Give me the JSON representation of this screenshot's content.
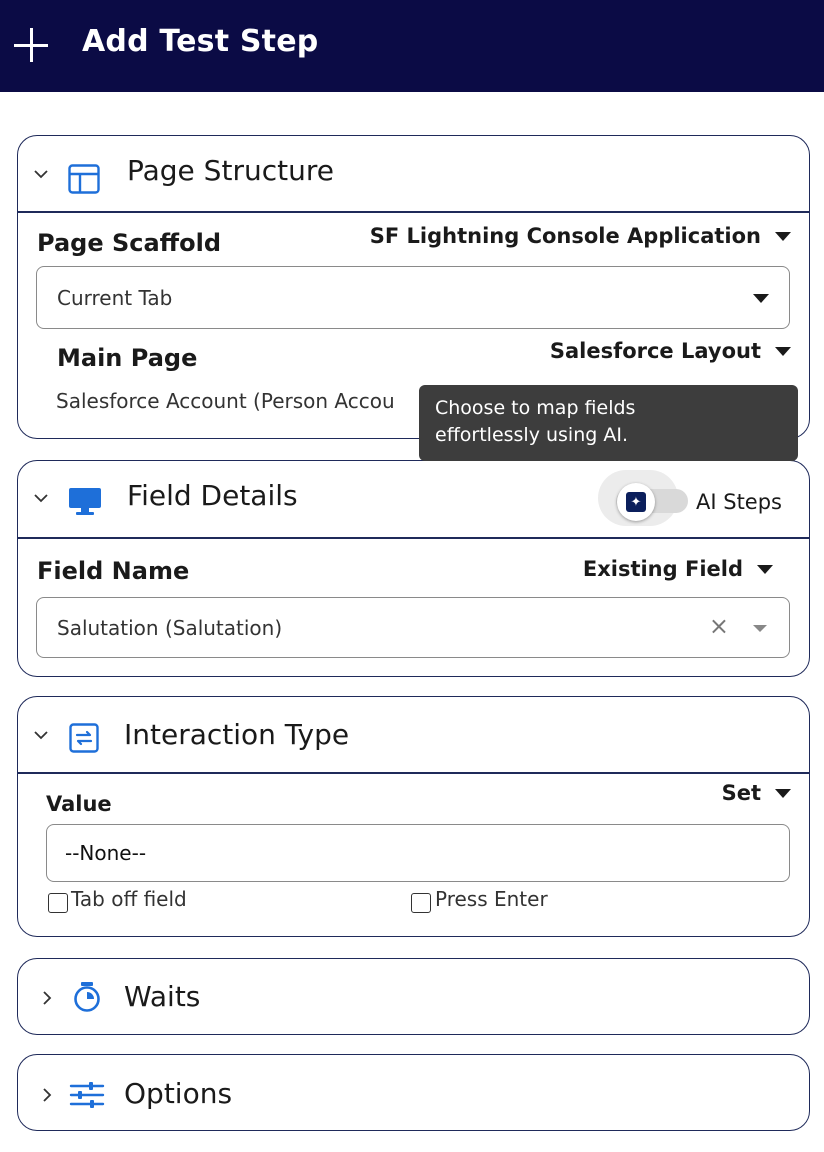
{
  "header": {
    "title": "Add Test Step",
    "icon": "plus-icon"
  },
  "page_structure": {
    "title": "Page Structure",
    "icon": "layout-icon",
    "scaffold_label": "Page Scaffold",
    "scaffold_mode": "SF Lightning Console Application",
    "scaffold_value": "Current Tab",
    "main_page_label": "Main Page",
    "main_page_mode": "Salesforce Layout",
    "main_page_value": "Salesforce Account (Person Accou"
  },
  "tooltip": {
    "line1": "Choose to map fields",
    "line2": "effortlessly using AI."
  },
  "field_details": {
    "title": "Field Details",
    "icon": "monitor-icon",
    "ai_toggle_label": "AI Steps",
    "ai_toggle_on": false,
    "field_name_label": "Field Name",
    "field_mode": "Existing Field",
    "field_value": "Salutation (Salutation)",
    "clear_glyph": "×"
  },
  "interaction_type": {
    "title": "Interaction Type",
    "icon": "interaction-icon",
    "value_label": "Value",
    "action": "Set",
    "value": "--None--",
    "tab_off_label": "Tab off field",
    "tab_off_checked": false,
    "press_enter_label": "Press Enter",
    "press_enter_checked": false
  },
  "waits": {
    "title": "Waits",
    "icon": "stopwatch-icon",
    "expanded": false
  },
  "options": {
    "title": "Options",
    "icon": "sliders-icon",
    "expanded": false
  },
  "colors": {
    "header_bg": "#0b0b45",
    "accent": "#1e6fd9",
    "border": "#1f2a5a",
    "tooltip_bg": "#3d3d3d"
  }
}
